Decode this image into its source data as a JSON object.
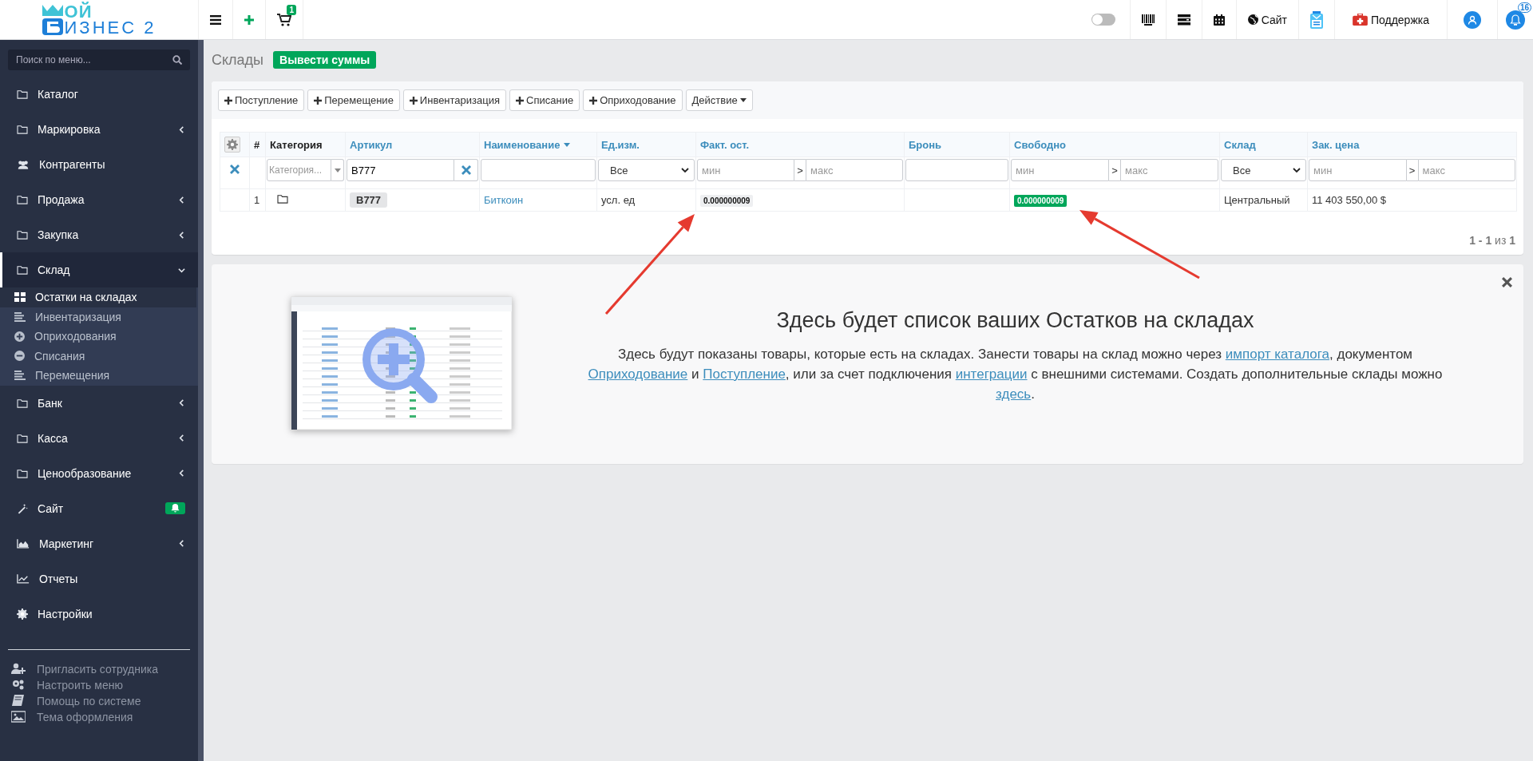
{
  "logo": {
    "line1": "ОЙ",
    "line2": "ИЗНЕС 2"
  },
  "topbar": {
    "cart_count": "1",
    "toggle": {
      "on": false
    },
    "site_link": "Сайт",
    "support_link": "Поддержка",
    "notification_count": "16"
  },
  "sidebar": {
    "search_placeholder": "Поиск по меню...",
    "items": [
      {
        "label": "Каталог",
        "kind": "link"
      },
      {
        "label": "Маркировка",
        "kind": "group",
        "expanded": false
      },
      {
        "label": "Контрагенты",
        "kind": "link"
      },
      {
        "label": "Продажа",
        "kind": "group",
        "expanded": false
      },
      {
        "label": "Закупка",
        "kind": "group",
        "expanded": false
      },
      {
        "label": "Склад",
        "kind": "group",
        "expanded": true,
        "children": [
          {
            "label": "Остатки на складах",
            "selected": true
          },
          {
            "label": "Инвентаризация",
            "selected": false
          },
          {
            "label": "Оприходования",
            "selected": false
          },
          {
            "label": "Списания",
            "selected": false
          },
          {
            "label": "Перемещения",
            "selected": false
          }
        ]
      },
      {
        "label": "Банк",
        "kind": "group",
        "expanded": false
      },
      {
        "label": "Касса",
        "kind": "group",
        "expanded": false
      },
      {
        "label": "Ценообразование",
        "kind": "group",
        "expanded": false
      },
      {
        "label": "Сайт",
        "kind": "link",
        "bell_badge": true
      },
      {
        "label": "Маркетинг",
        "kind": "group",
        "expanded": false
      },
      {
        "label": "Отчеты",
        "kind": "link"
      },
      {
        "label": "Настройки",
        "kind": "link"
      }
    ],
    "footer": [
      "Пригласить сотрудника",
      "Настроить меню",
      "Помощь по системе",
      "Тема оформления"
    ]
  },
  "page": {
    "title": "Склады",
    "sums_button": "Вывести суммы"
  },
  "toolbar": [
    {
      "label": "Поступление",
      "kind": "add"
    },
    {
      "label": "Перемещение",
      "kind": "add"
    },
    {
      "label": "Инвентаризация",
      "kind": "add"
    },
    {
      "label": "Списание",
      "kind": "add"
    },
    {
      "label": "Оприходование",
      "kind": "add"
    },
    {
      "label": "Действие",
      "kind": "dropdown"
    }
  ],
  "table": {
    "columns": [
      {
        "kind": "settings"
      },
      {
        "label": "#",
        "kind": "plain"
      },
      {
        "label": "Категория",
        "kind": "plain"
      },
      {
        "label": "Артикул",
        "kind": "sortable",
        "sorted": false
      },
      {
        "label": "Наименование",
        "kind": "sortable",
        "sorted": true
      },
      {
        "label": "Ед.изм.",
        "kind": "sortable",
        "sorted": false
      },
      {
        "label": "Факт. ост.",
        "kind": "sortable",
        "sorted": false
      },
      {
        "label": "Бронь",
        "kind": "sortable",
        "sorted": false
      },
      {
        "label": "Свободно",
        "kind": "sortable",
        "sorted": false
      },
      {
        "label": "Склад",
        "kind": "sortable",
        "sorted": false
      },
      {
        "label": "Зак. цена",
        "kind": "sortable",
        "sorted": false
      }
    ],
    "filters": [
      {
        "kind": "clear"
      },
      {
        "kind": "blank"
      },
      {
        "kind": "combo",
        "placeholder": "Категория..."
      },
      {
        "kind": "text",
        "value": "B777",
        "clearable": true
      },
      {
        "kind": "text",
        "clearable": false
      },
      {
        "kind": "select",
        "value": "Все"
      },
      {
        "kind": "range",
        "min_placeholder": "мин",
        "separator": ">",
        "max_placeholder": "макс"
      },
      {
        "kind": "text",
        "clearable": false
      },
      {
        "kind": "range",
        "min_placeholder": "мин",
        "separator": ">",
        "max_placeholder": "макс"
      },
      {
        "kind": "select",
        "value": "Все"
      },
      {
        "kind": "range",
        "min_placeholder": "мин",
        "separator": ">",
        "max_placeholder": "макс"
      }
    ],
    "rows": [
      {
        "number": "1",
        "article": "B777",
        "name": "Биткоин",
        "unit": "усл. ед",
        "actual": "0.000000009",
        "free": "0.000000009",
        "warehouse": "Центральный",
        "price": "11 403 550,00 $"
      }
    ]
  },
  "pagination": "**1 - 1** из **1**",
  "empty_state": {
    "title": "Здесь будет список ваших Остатков на складах",
    "paragraph": [
      {
        "text": "Здесь будут показаны товары, которые есть на складах. Занести товары на склад можно через ",
        "link": false
      },
      {
        "text": "импорт каталога",
        "link": true
      },
      {
        "text": ", документом ",
        "link": false
      },
      {
        "text": "Оприходование",
        "link": true
      },
      {
        "text": " и ",
        "link": false
      },
      {
        "text": "Поступление",
        "link": true
      },
      {
        "text": ", или за счет подключения ",
        "link": false
      },
      {
        "text": "интеграции",
        "link": true
      },
      {
        "text": " с внешними системами. Создать дополнительные склады можно ",
        "link": false
      },
      {
        "text": "здесь",
        "link": true
      },
      {
        "text": ".",
        "link": false
      }
    ]
  }
}
